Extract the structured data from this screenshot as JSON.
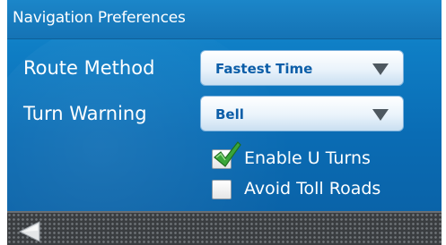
{
  "header": {
    "title": "Navigation Preferences"
  },
  "settings": {
    "route_method": {
      "label": "Route Method",
      "value": "Fastest Time"
    },
    "turn_warning": {
      "label": "Turn Warning",
      "value": "Bell"
    }
  },
  "options": {
    "enable_u_turns": {
      "label": "Enable U Turns",
      "checked": true
    },
    "avoid_toll_roads": {
      "label": "Avoid Toll Roads",
      "checked": false
    }
  },
  "colors": {
    "panel_blue": "#0f7fc6",
    "dropdown_text": "#0c5ea8",
    "check_green": "#3aa63a",
    "bottom_bar": "#3a3d40"
  },
  "icons": {
    "dropdown": "chevron-down-icon",
    "check": "checkmark-icon",
    "back": "back-arrow-icon"
  }
}
